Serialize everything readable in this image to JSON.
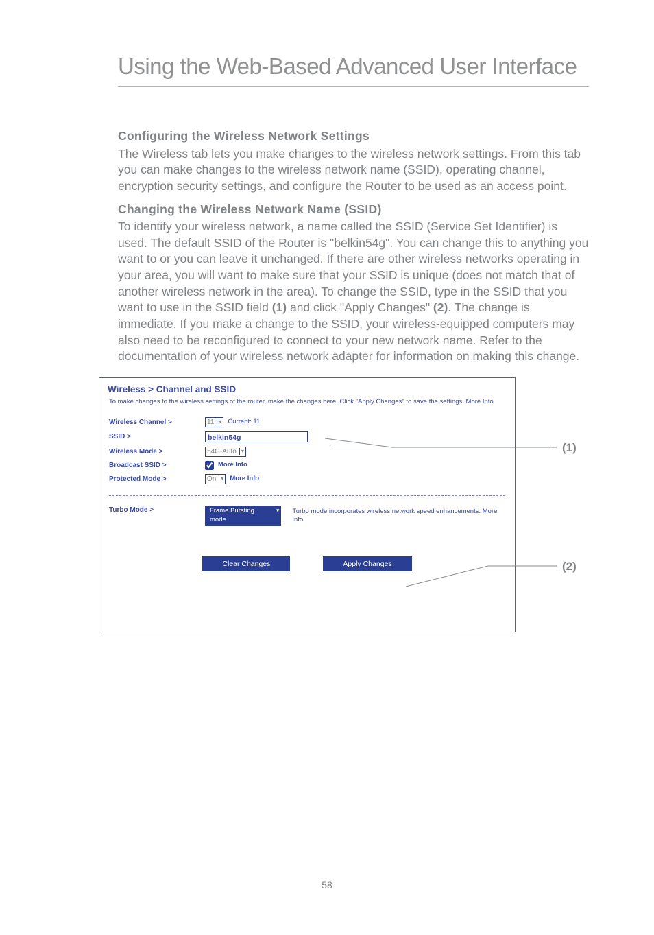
{
  "page_title": "Using the Web-Based Advanced User Interface",
  "sections": {
    "config": {
      "heading": "Configuring the Wireless Network Settings",
      "body": "The Wireless tab lets you make changes to the wireless network settings. From this tab you can make changes to the wireless network name (SSID), operating channel, encryption security settings, and configure the Router to be used as an access point."
    },
    "ssid": {
      "heading": "Changing the Wireless Network Name (SSID)",
      "body_before_1": "To identify your wireless network, a name called the SSID (Service Set Identifier) is used. The default SSID of the Router is \"belkin54g\". You can change this to anything you want to or you can leave it unchanged. If there are other wireless networks operating in your area, you will want to make sure that your SSID is unique (does not match that of another wireless network in the area). To change the SSID, type in the SSID that you want to use in the SSID field ",
      "ref1": "(1)",
      "body_mid": " and click \"Apply Changes\" ",
      "ref2": "(2)",
      "body_after": ". The change is immediate. If you make a change to the SSID, your wireless-equipped computers may also need to be reconfigured to connect to your new network name. Refer to the documentation of your wireless network adapter for information on making this change."
    }
  },
  "panel": {
    "title": "Wireless > Channel and SSID",
    "subtitle": "To make changes to the wireless settings of the router, make the changes here. Click \"Apply Changes\" to save the settings. More Info",
    "rows": {
      "channel": {
        "label": "Wireless Channel >",
        "value": "11",
        "current": "Current: 11"
      },
      "ssid": {
        "label": "SSID >",
        "value": "belkin54g"
      },
      "mode": {
        "label": "Wireless Mode >",
        "value": "54G-Auto"
      },
      "broadcast": {
        "label": "Broadcast SSID >",
        "note": "More Info"
      },
      "protected": {
        "label": "Protected Mode >",
        "value": "On",
        "note": "More Info"
      },
      "turbo": {
        "label": "Turbo Mode >",
        "value": "Frame Bursting mode",
        "desc": "Turbo mode incorporates wireless network speed enhancements. More Info"
      }
    },
    "buttons": {
      "clear": "Clear Changes",
      "apply": "Apply Changes"
    }
  },
  "callouts": {
    "one": "(1)",
    "two": "(2)"
  },
  "page_number": "58"
}
